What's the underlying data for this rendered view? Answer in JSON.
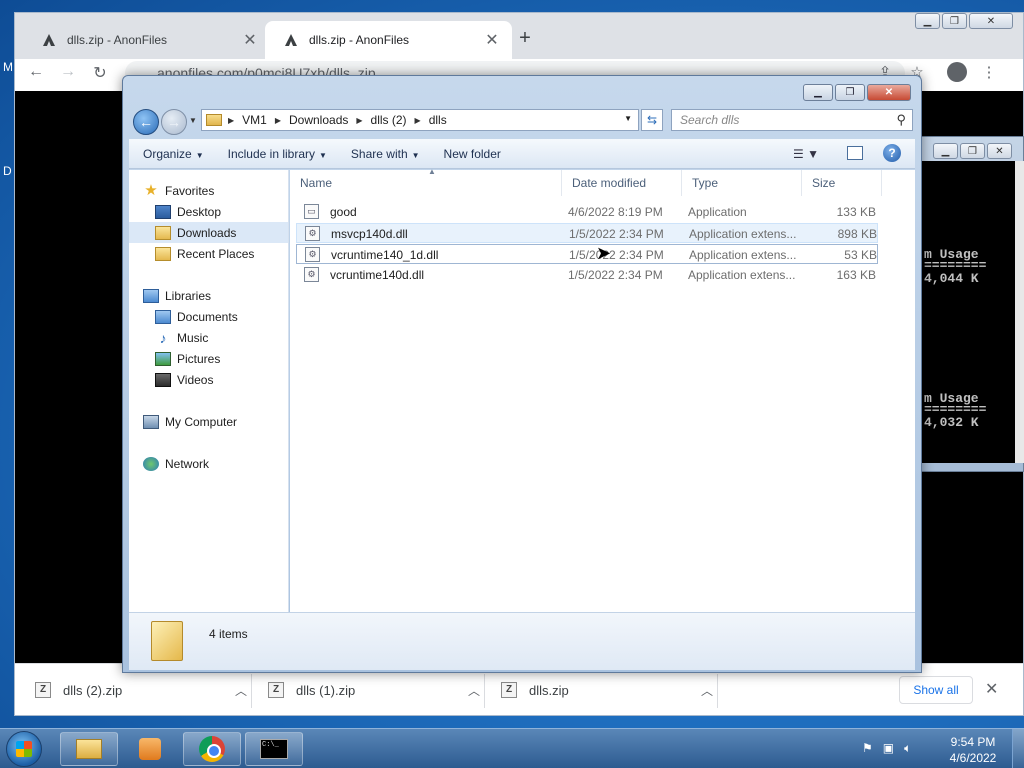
{
  "desktop": {
    "left_letter_1": "M",
    "left_letter_2": "D"
  },
  "chrome": {
    "tabs": [
      {
        "title": "dlls.zip - AnonFiles",
        "close": "✕"
      },
      {
        "title": "dlls.zip - AnonFiles",
        "close": "✕"
      }
    ],
    "new_tab": "+",
    "url": "anonfiles.com/p0mci8U7xb/dlls_zip",
    "nav": {
      "back": "←",
      "forward": "→",
      "reload": "↻"
    },
    "downloads": [
      {
        "name": "dlls (2).zip",
        "icon": "Z"
      },
      {
        "name": "dlls (1).zip",
        "icon": "Z"
      },
      {
        "name": "dlls.zip",
        "icon": "Z"
      }
    ],
    "show_all": "Show all",
    "shelf_close": "✕"
  },
  "cmd": {
    "lines": [
      "m Usage",
      "========",
      "4,044 K",
      "m Usage",
      "========",
      "4,032 K"
    ]
  },
  "explorer": {
    "breadcrumb": [
      "VM1",
      "Downloads",
      "dlls (2)",
      "dlls"
    ],
    "search_placeholder": "Search dlls",
    "toolbar": {
      "organize": "Organize",
      "include_in_library": "Include in library",
      "share_with": "Share with",
      "new_folder": "New folder"
    },
    "nav_pane": {
      "favorites": "Favorites",
      "desktop": "Desktop",
      "downloads": "Downloads",
      "recent_places": "Recent Places",
      "libraries": "Libraries",
      "documents": "Documents",
      "music": "Music",
      "pictures": "Pictures",
      "videos": "Videos",
      "my_computer": "My Computer",
      "network": "Network"
    },
    "columns": {
      "name": "Name",
      "date": "Date modified",
      "type": "Type",
      "size": "Size"
    },
    "files": [
      {
        "name": "good",
        "date": "4/6/2022 8:19 PM",
        "type": "Application",
        "size": "133 KB"
      },
      {
        "name": "msvcp140d.dll",
        "date": "1/5/2022 2:34 PM",
        "type": "Application extens...",
        "size": "898 KB"
      },
      {
        "name": "vcruntime140_1d.dll",
        "date": "1/5/2022 2:34 PM",
        "type": "Application extens...",
        "size": "53 KB"
      },
      {
        "name": "vcruntime140d.dll",
        "date": "1/5/2022 2:34 PM",
        "type": "Application extens...",
        "size": "163 KB"
      }
    ],
    "item_count": "4 items"
  },
  "taskbar": {
    "clock_time": "9:54 PM",
    "clock_date": "4/6/2022",
    "cmd_icon_text": "C:\\_"
  }
}
